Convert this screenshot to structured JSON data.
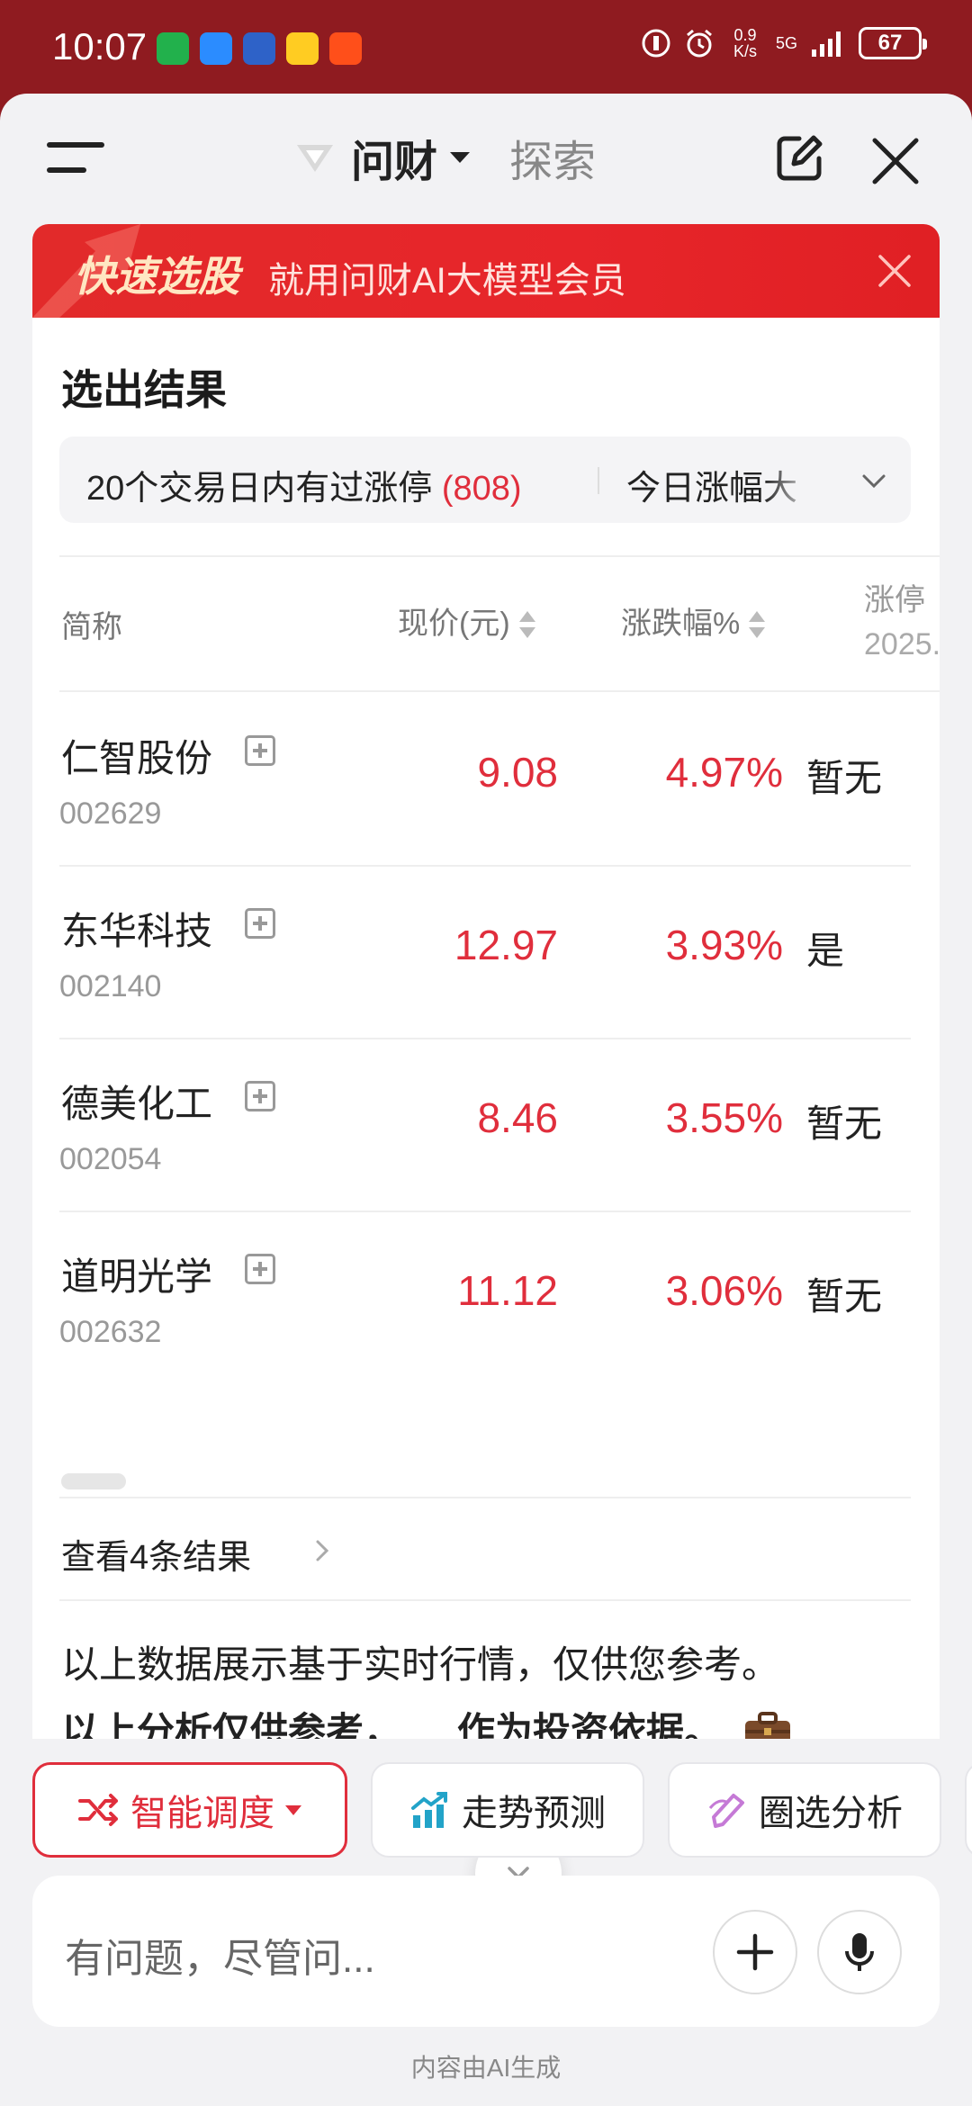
{
  "status_bar": {
    "time": "10:07",
    "net_speed": "0.9\nK/s",
    "net_type": "5G",
    "battery": "67"
  },
  "header": {
    "title": "问财",
    "explore": "探索"
  },
  "promo": {
    "title": "快速选股",
    "subtitle": "就用问财AI大模型会员"
  },
  "results": {
    "title": "选出结果",
    "filter_condition": "20个交易日内有过涨停",
    "filter_count": "(808)",
    "sort_label": "今日涨幅大",
    "columns": {
      "name": "简称",
      "price": "现价(元)",
      "change": "涨跌幅%",
      "limit": "涨停",
      "limit_sub": "2025."
    },
    "rows": [
      {
        "name": "仁智股份",
        "code": "002629",
        "price": "9.08",
        "change": "4.97%",
        "limit": "暂无"
      },
      {
        "name": "东华科技",
        "code": "002140",
        "price": "12.97",
        "change": "3.93%",
        "limit": "是"
      },
      {
        "name": "德美化工",
        "code": "002054",
        "price": "8.46",
        "change": "3.55%",
        "limit": "暂无"
      },
      {
        "name": "道明光学",
        "code": "002632",
        "price": "11.12",
        "change": "3.06%",
        "limit": "暂无"
      }
    ],
    "more_link": "查看4条结果"
  },
  "note": {
    "line1": "以上数据展示基于实时行情，仅供您参考。",
    "line2_a": "以上分析仅供参考，",
    "line2_b": "作为投资依据。",
    "sparkle": "✨"
  },
  "chips": [
    {
      "label": "智能调度"
    },
    {
      "label": "走势预测"
    },
    {
      "label": "圈选分析"
    }
  ],
  "composer": {
    "placeholder": "有问题，尽管问..."
  },
  "footer": "内容由AI生成",
  "colors": {
    "accent_red": "#e02e3c",
    "status_bg": "#8f1b20",
    "promo_bg": "#e22a2a"
  },
  "icons": [
    "menu-icon",
    "logo-icon",
    "edit-icon",
    "close-icon",
    "chevron-down-icon",
    "sort-icon",
    "add-watch-icon",
    "chevron-right-icon",
    "briefcase-icon",
    "shuffle-icon",
    "trend-chart-icon",
    "pen-select-icon",
    "plus-icon",
    "mic-icon"
  ]
}
